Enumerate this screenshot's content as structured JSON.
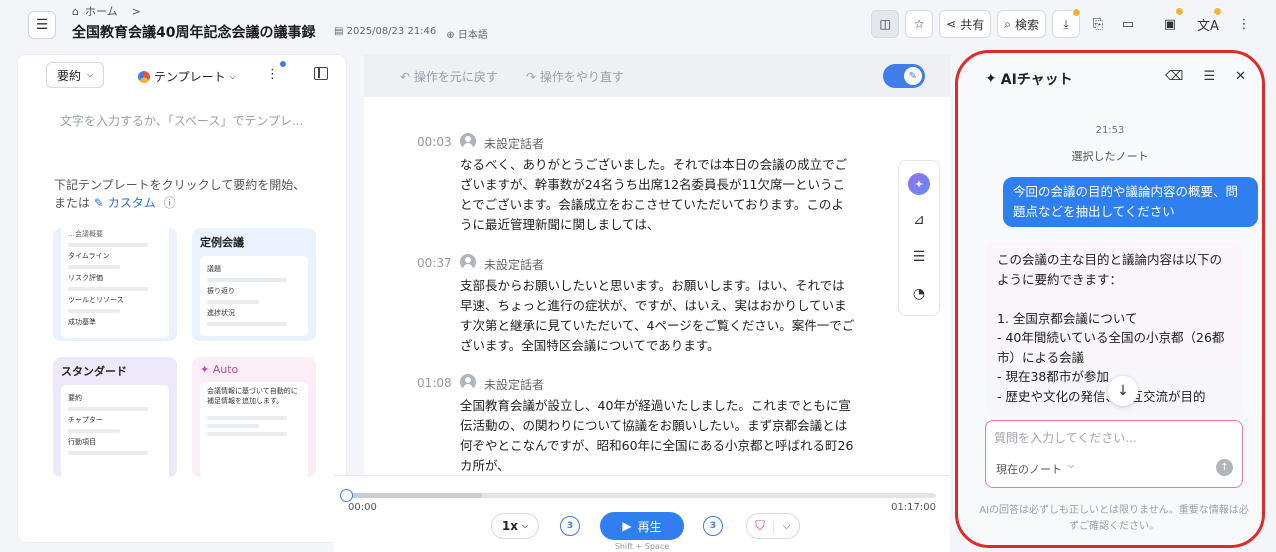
{
  "breadcrumb": {
    "home": "ホーム",
    "arrow": ">"
  },
  "document": {
    "title": "全国教育会議40周年記念会議の議事録",
    "datetime": "2025/08/23 21:46",
    "language": "日本語"
  },
  "toolbar": {
    "share": "共有",
    "search": "検索"
  },
  "left_panel": {
    "summary_select": "要約",
    "template_select": "テンプレート",
    "placeholder": "文字を入力するか、「スペース」でテンプレ...",
    "hint_line1": "下記テンプレートをクリックして要約を開始、",
    "hint_or": "または",
    "hint_custom": "カスタム",
    "cards": {
      "first": {
        "partial": "…会議概要",
        "items": [
          "タイムライン",
          "リスク評価",
          "ツールとリソース",
          "成功基準"
        ]
      },
      "regular": {
        "title": "定例会議",
        "items": [
          "議題",
          "振り返り",
          "進捗状況"
        ]
      },
      "standard": {
        "title": "スタンダード",
        "items": [
          "要約",
          "チャプター",
          "行動項目"
        ]
      },
      "auto": {
        "title": "Auto",
        "desc": "会議情報に基づいて自動的に補足情報を追加します。"
      }
    }
  },
  "editor": {
    "undo": "操作を元に戻す",
    "redo": "操作をやり直す"
  },
  "transcript": [
    {
      "time": "00:03",
      "speaker": "未設定話者",
      "text": "なるべく、ありがとうございました。それでは本日の会議の成立でございますが、幹事数が24名うち出席12名委員長が11欠席一ということでございます。会議成立をおこさせていただいております。このように最近管理新聞に関しましては、"
    },
    {
      "time": "00:37",
      "speaker": "未設定話者",
      "text": "支部長からお願いしたいと思います。お願いします。はい、それでは早速、ちょっと進行の症状が、ですが、はいえ、実はおかりしています次第と継承に見ていただいて、4ページをご覧ください。案件一でございます。全国特区会議についてであります。"
    },
    {
      "time": "01:08",
      "speaker": "未設定話者",
      "text": "全国教育会議が設立し、40年が経過いたしました。これまでともに宣伝活動の、の関わりについて協議をお願いしたい。まず京都会議とは何ぞやとこなんですが、昭和60年に全国にある小京都と呼ばれる町26カ所が、"
    }
  ],
  "player": {
    "current": "00:00",
    "duration": "01:17:00",
    "speed": "1x",
    "skip": "3",
    "play": "再生",
    "shortcut": "Shift + Space",
    "progress_buffered": 0.23
  },
  "chat": {
    "title": "AIチャット",
    "time": "21:53",
    "selected_note": "選択したノート",
    "user_message": "今回の会議の目的や議論内容の概要、問題点などを抽出してください",
    "ai_lines": [
      "この会議の主な目的と議論内容は以下のように要約できます：",
      "",
      "1. 全国京都会議について",
      "- 40年間続いている全国の小京都（26都市）による会議",
      "- 現在38都市が参加",
      "- 歴史や文化の発信、相互交流が目的"
    ],
    "input_placeholder": "質問を入力してください...",
    "scope": "現在のノート",
    "disclaimer": "AIの回答は必ずしも正しいとは限りません。重要な情報は必ずご確認ください。"
  },
  "colors": {
    "accent": "#2f7ff0",
    "highlight_border": "#e02a2a"
  }
}
